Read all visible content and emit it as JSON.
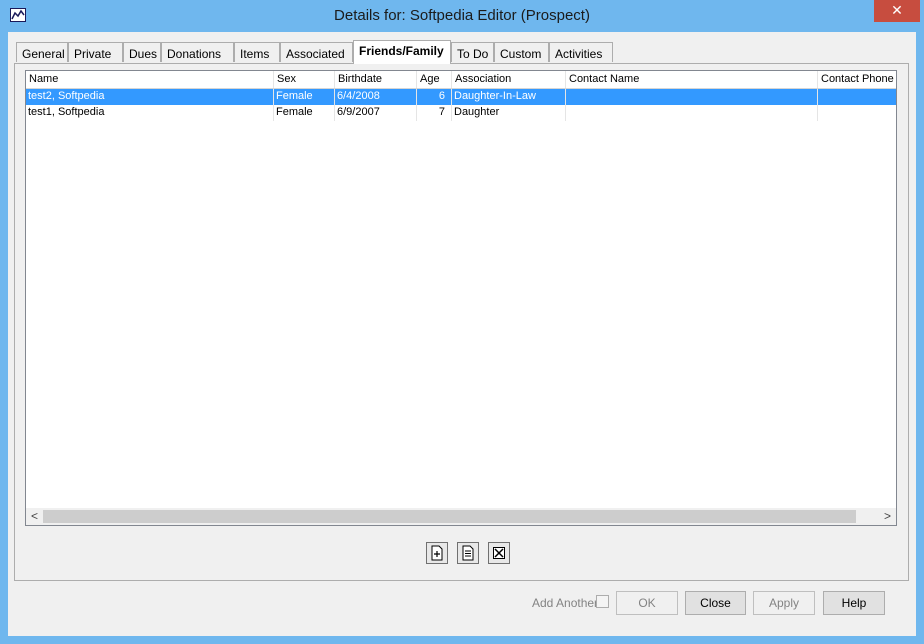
{
  "window": {
    "title": "Details for: Softpedia Editor (Prospect)",
    "close_glyph": "✕",
    "icon": "chart-app-icon"
  },
  "tabs": [
    {
      "label": "General"
    },
    {
      "label": "Private"
    },
    {
      "label": "Dues"
    },
    {
      "label": "Donations"
    },
    {
      "label": "Items"
    },
    {
      "label": "Associated"
    },
    {
      "label": "Friends/Family",
      "active": true
    },
    {
      "label": "To Do"
    },
    {
      "label": "Custom"
    },
    {
      "label": "Activities"
    }
  ],
  "list": {
    "columns": [
      "Name",
      "Sex",
      "Birthdate",
      "Age",
      "Association",
      "Contact Name",
      "Contact Phone"
    ],
    "rows": [
      {
        "name": "test2, Softpedia",
        "sex": "Female",
        "birthdate": "6/4/2008",
        "age": "6",
        "association": "Daughter-In-Law",
        "contact_name": "",
        "contact_phone": "",
        "selected": true
      },
      {
        "name": "test1, Softpedia",
        "sex": "Female",
        "birthdate": "6/9/2007",
        "age": "7",
        "association": "Daughter",
        "contact_name": "",
        "contact_phone": "",
        "selected": false
      }
    ]
  },
  "scroll": {
    "left": "<",
    "right": ">"
  },
  "actions": {
    "add_icon": "add-document-icon",
    "edit_icon": "edit-document-icon",
    "delete_icon": "delete-icon"
  },
  "footer": {
    "add_another_label": "Add Another",
    "ok_label": "OK",
    "close_label": "Close",
    "apply_label": "Apply",
    "help_label": "Help"
  },
  "colors": {
    "selection": "#3399ff",
    "titlebar": "#6fb7ee",
    "close_button": "#c74d3f"
  }
}
